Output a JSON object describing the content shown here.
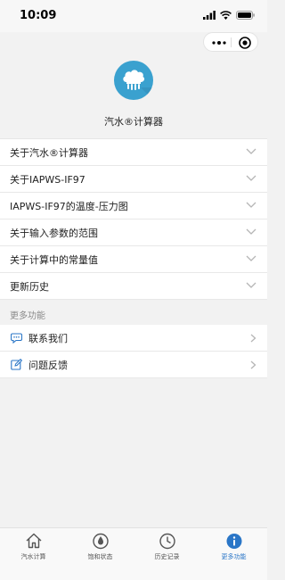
{
  "status_bar": {
    "time": "10:09"
  },
  "app": {
    "name": "汽水®计算器"
  },
  "menu": [
    {
      "label": "关于汽水®计算器"
    },
    {
      "label": "关于IAPWS-IF97"
    },
    {
      "label": "IAPWS-IF97的温度-压力图"
    },
    {
      "label": "关于输入参数的范围"
    },
    {
      "label": "关于计算中的常量值"
    },
    {
      "label": "更新历史"
    }
  ],
  "more_section": {
    "title": "更多功能",
    "items": [
      {
        "label": "联系我们",
        "icon": "chat-icon"
      },
      {
        "label": "问题反馈",
        "icon": "edit-icon"
      }
    ]
  },
  "tabbar": {
    "active": "more",
    "tabs": [
      {
        "label": "汽水计算",
        "icon": "home-icon"
      },
      {
        "label": "饱和状态",
        "icon": "drop-icon"
      },
      {
        "label": "历史记录",
        "icon": "clock-icon"
      },
      {
        "label": "更多功能",
        "icon": "info-icon"
      }
    ]
  },
  "colors": {
    "accent": "#2a76c7",
    "logo": "#3aa1cf"
  }
}
